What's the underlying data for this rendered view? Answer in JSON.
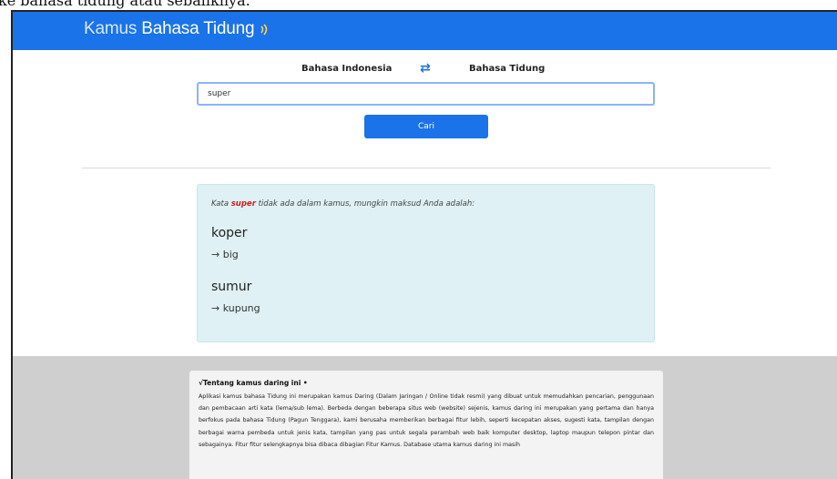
{
  "top_strip": {
    "text": "ke bahasa tidung atau sebaliknya."
  },
  "navbar": {
    "brand_part1": "Kamus",
    "brand_part2": "Bahasa Tidung",
    "brand_icon": "sound-wave-icon"
  },
  "language": {
    "from": "Bahasa Indonesia",
    "to": "Bahasa Tidung",
    "swap_icon": "swap-arrows-icon"
  },
  "search": {
    "value": "super",
    "button_label": "Cari"
  },
  "result": {
    "msg_prefix": "Kata",
    "keyword": "super",
    "msg_suffix": "tidak ada dalam kamus, mungkin maksud Anda adalah:",
    "suggestions": [
      {
        "word": "koper",
        "translation": "→ big"
      },
      {
        "word": "sumur",
        "translation": "→ kupung"
      }
    ]
  },
  "about": {
    "title": "√Tentang kamus daring ini •",
    "text": "Aplikasi kamus bahasa Tidung ini merupakan kamus Daring (Dalam Jaringan / Online tidak resmi) yang dibuat untuk memudahkan pencarian, penggunaan dan pembacaan arti kata (lema/sub lema). Berbeda dengan beberapa situs web (website) sejenis, kamus daring ini merupakan yang pertama dan hanya berfokus pada bahasa Tidung (Pagun Tenggara), kami berusaha memberikan berbagai fitur lebih, seperti kecepatan akses, sugesti kata, tampilan dengan berbagai warna pembeda untuk jenis kata, tampilan yang pas untuk segala perambah web baik komputer desktop, laptop maupun telepon pintar dan sebagainya. Fitur fitur selengkapnya bisa dibaca dibagian Fitur Kamus. Database utama kamus daring ini masih"
  },
  "colors": {
    "primary": "#1a73e8",
    "result_bg": "#dff1f4",
    "keyword": "#d01e1e",
    "footer_bg": "#cfcfcf"
  }
}
